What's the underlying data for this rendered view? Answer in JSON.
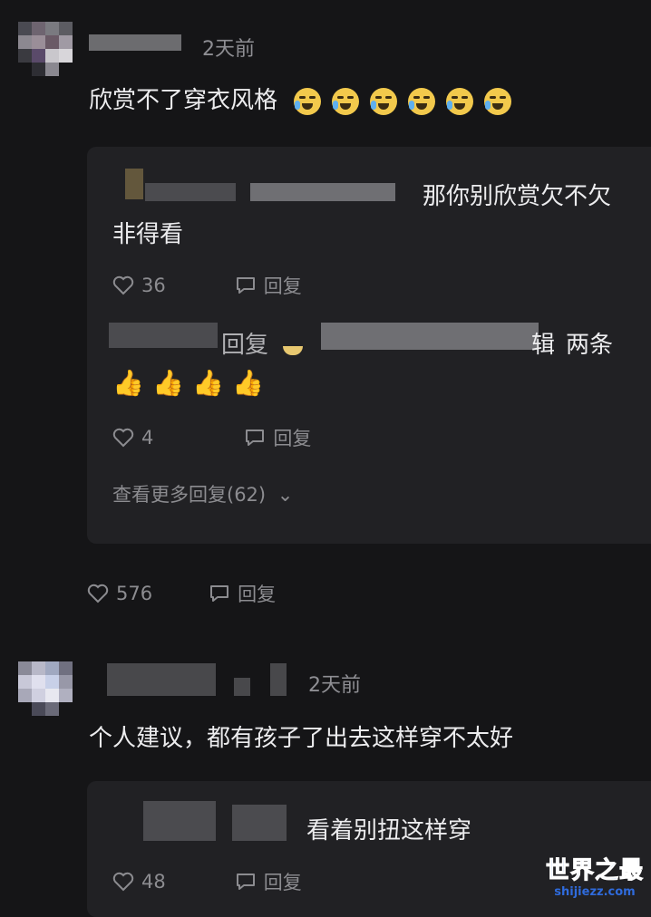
{
  "comment1": {
    "username": "",
    "time": "2天前",
    "text": "欣赏不了穿衣风格",
    "emoji_count": 6,
    "emoji_name": "crying-laughing-emoji",
    "likes": "576",
    "reply_label": "回复",
    "thread": {
      "reply1": {
        "text_line1": "那你别欣赏欠不欠",
        "text_line2": "非得看",
        "likes": "36",
        "reply_label": "回复"
      },
      "reply2": {
        "prefix": "回复",
        "text_end": "两条",
        "partial": "辑",
        "thumbs": 4,
        "likes": "4",
        "reply_label": "回复"
      },
      "more": "查看更多回复(62)"
    }
  },
  "comment2": {
    "time": "2天前",
    "text": "个人建议，都有孩子了出去这样穿不太好",
    "thread": {
      "reply1": {
        "text": "看着别扭这样穿",
        "likes": "48",
        "reply_label": "回复"
      }
    }
  },
  "watermark": {
    "title": "世界之最",
    "url": "shijiezz.com"
  }
}
